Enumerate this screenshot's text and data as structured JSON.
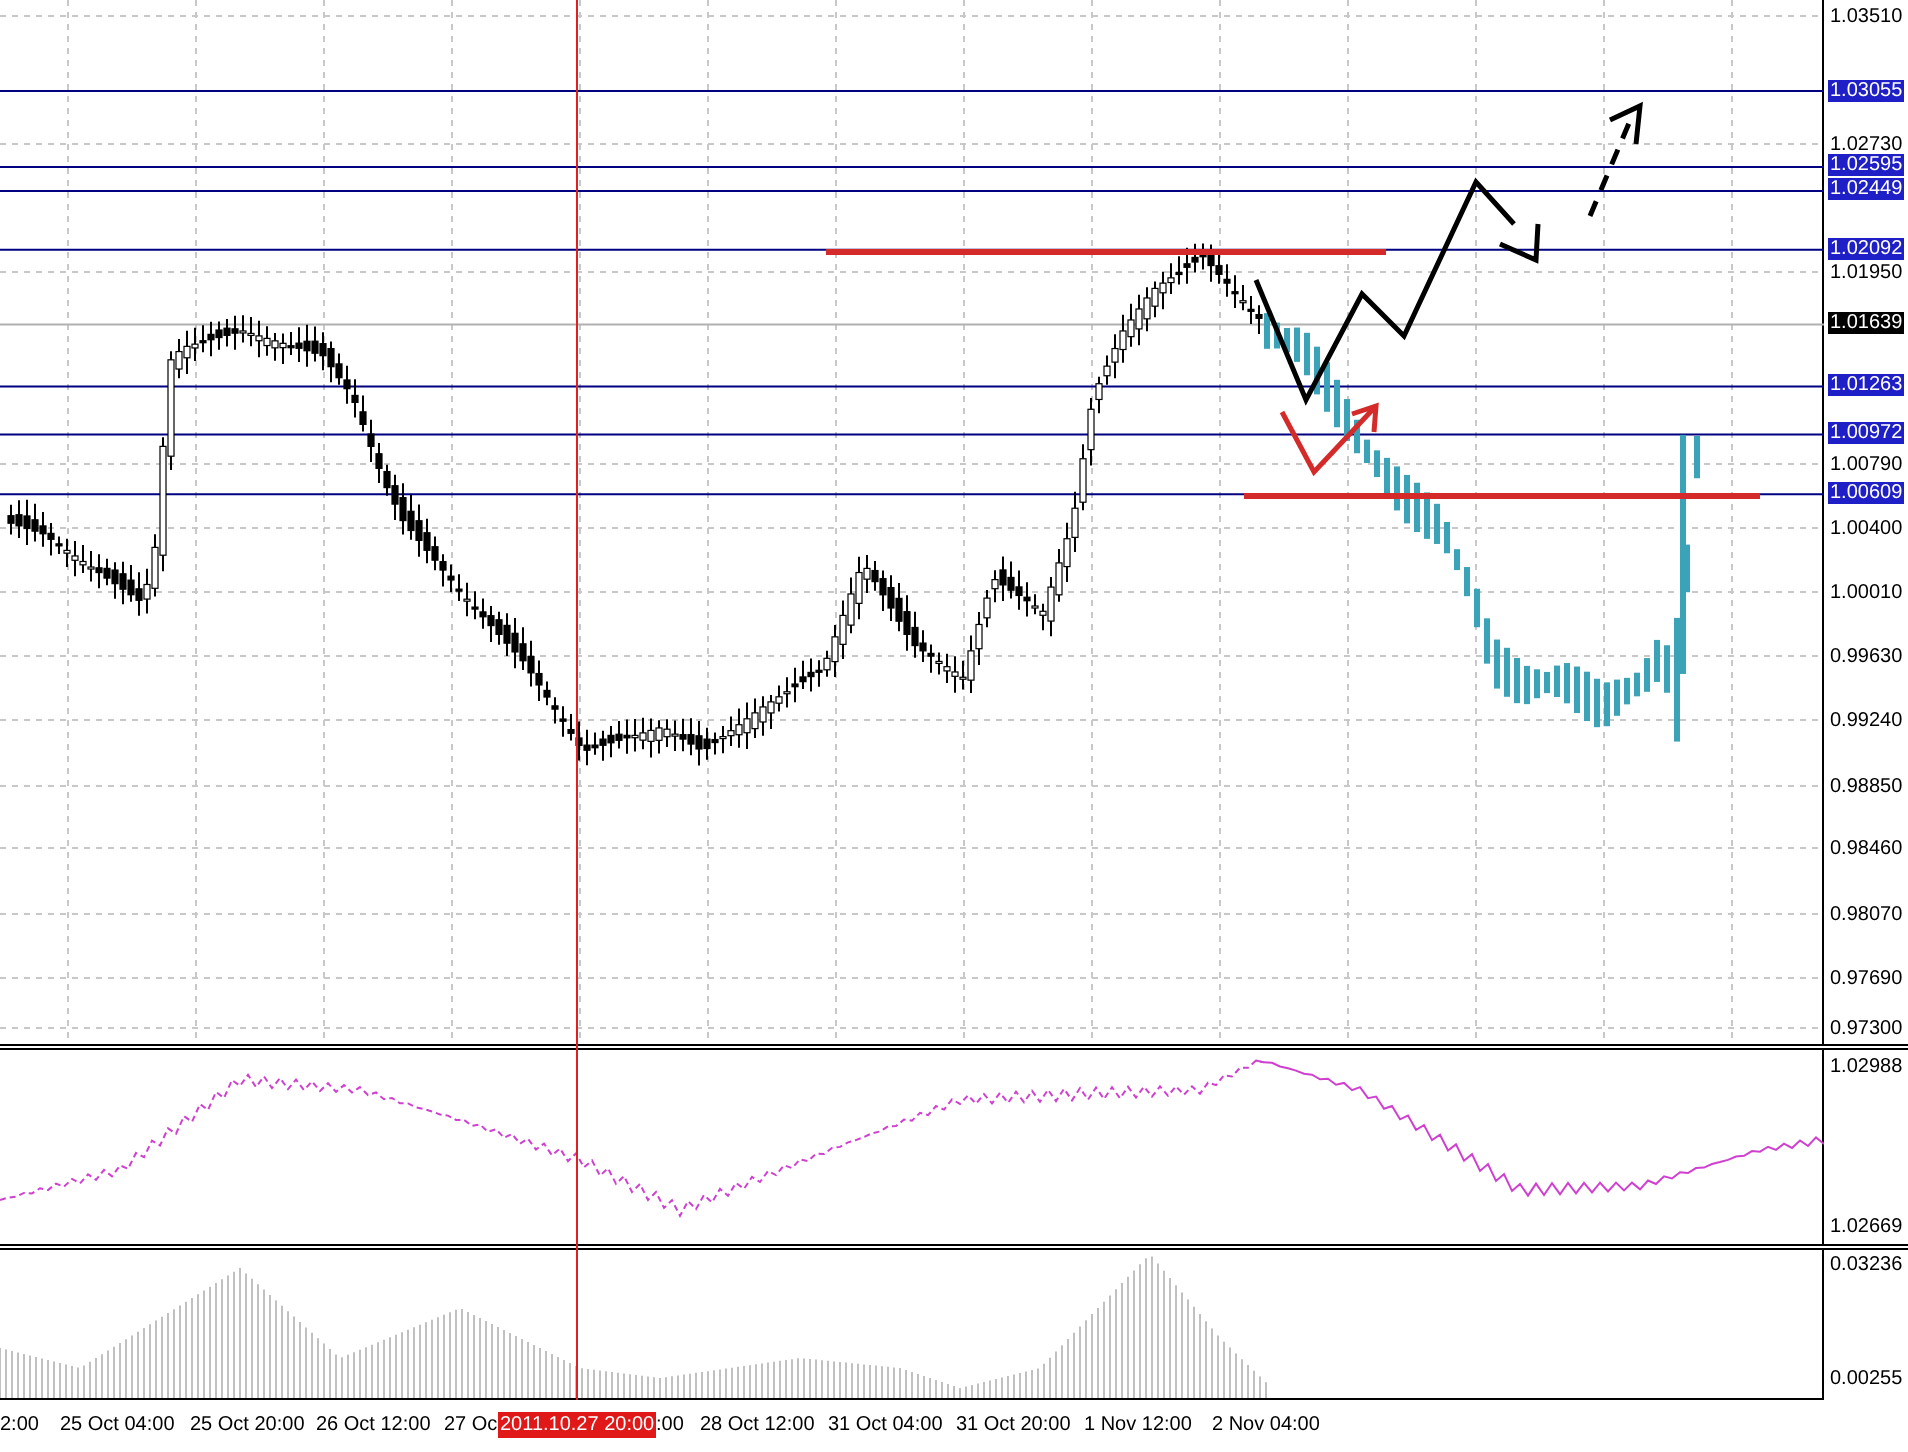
{
  "chart": {
    "price_axis": [
      "1.03510",
      "1.02730",
      "1.01950",
      "1.00790",
      "1.00400",
      "1.00010",
      "0.99630",
      "0.99240",
      "0.98850",
      "0.98460",
      "0.98070",
      "0.97690",
      "0.97300"
    ],
    "levels": [
      {
        "label": "1.03055",
        "kind": "level"
      },
      {
        "label": "1.02595",
        "kind": "level"
      },
      {
        "label": "1.02449",
        "kind": "level"
      },
      {
        "label": "1.02092",
        "kind": "level"
      },
      {
        "label": "1.01639",
        "kind": "current"
      },
      {
        "label": "1.01263",
        "kind": "level"
      },
      {
        "label": "1.00972",
        "kind": "level"
      },
      {
        "label": "1.00609",
        "kind": "level"
      }
    ],
    "crosshair_time": "2011.10.27 20:00",
    "time_axis": [
      "2:00",
      "25 Oct 04:00",
      "25 Oct 20:00",
      "26 Oct 12:00",
      "27 Oc",
      ":00",
      "28 Oct 12:00",
      "31 Oct 04:00",
      "31 Oct 20:00",
      "1 Nov 12:00",
      "2 Nov 04:00"
    ]
  },
  "indicator_1": {
    "axis": [
      "1.02988",
      "1.02669"
    ]
  },
  "indicator_2": {
    "axis": [
      "0.03236",
      "0.00255"
    ]
  }
}
